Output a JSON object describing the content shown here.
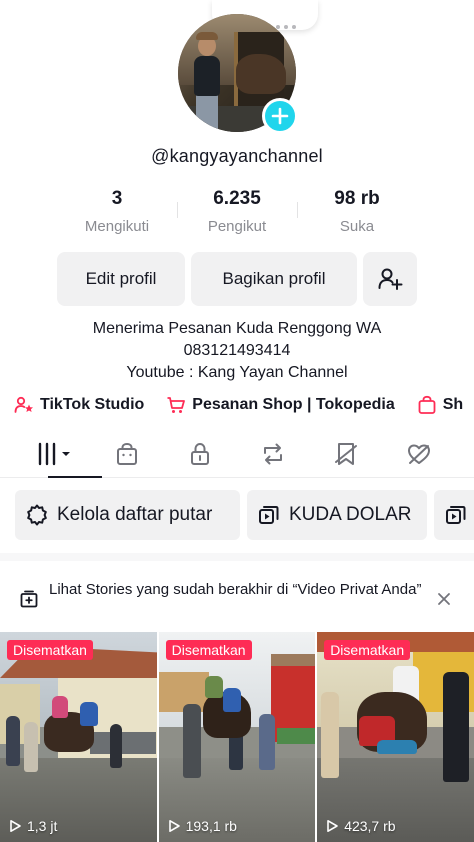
{
  "profile": {
    "username": "@kangyayanchannel"
  },
  "stats": [
    {
      "value": "3",
      "label": "Mengikuti"
    },
    {
      "value": "6.235",
      "label": "Pengikut"
    },
    {
      "value": "98 rb",
      "label": "Suka"
    }
  ],
  "buttons": {
    "edit_profile": "Edit profil",
    "share_profile": "Bagikan profil"
  },
  "bio": {
    "line1": "Menerima Pesanan Kuda Renggong WA",
    "line2": "083121493414",
    "line3": "Youtube : Kang Yayan Channel"
  },
  "links": {
    "studio": "TikTok Studio",
    "shop": "Pesanan Shop | Tokopedia",
    "shop_truncated": "Sh"
  },
  "playlists": {
    "manage": "Kelola daftar putar",
    "kuda_dolar": "KUDA DOLAR"
  },
  "stories_notice": {
    "text": "Lihat Stories yang sudah berakhir di “Video Privat Anda”"
  },
  "videos": [
    {
      "badge": "Disematkan",
      "views": "1,3 jt"
    },
    {
      "badge": "Disematkan",
      "views": "193,1 rb"
    },
    {
      "badge": "Disematkan",
      "views": "423,7 rb"
    }
  ],
  "colors": {
    "accent_cyan": "#20d5ec",
    "pinned_red": "#fe2c55",
    "text_primary": "#161823",
    "text_secondary": "#8a8b91",
    "button_bg": "#f1f1f2"
  },
  "icons": {
    "tabs": [
      "videos-grid-icon",
      "shop-bag-icon",
      "lock-icon",
      "repost-icon",
      "favorites-icon",
      "liked-icon"
    ]
  }
}
